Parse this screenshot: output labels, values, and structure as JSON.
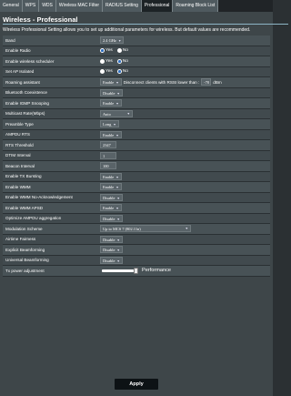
{
  "tabs": [
    "General",
    "WPS",
    "WDS",
    "Wireless MAC Filter",
    "RADIUS Setting",
    "Professional",
    "Roaming Block List"
  ],
  "active_tab": "Professional",
  "title": "Wireless - Professional",
  "description": "Wireless Professional Setting allows you to set up additional parameters for wireless. But default values are recommended.",
  "radio_yes": "Yes",
  "radio_no": "No",
  "rows": {
    "band": {
      "label": "Band",
      "value": "2.4 GHz"
    },
    "enable_radio": {
      "label": "Enable Radio",
      "selected": "Yes"
    },
    "scheduler": {
      "label": "Enable wireless scheduler",
      "selected": "No"
    },
    "ap_isolated": {
      "label": "Set AP Isolated",
      "selected": "No"
    },
    "roaming": {
      "label": "Roaming assistant",
      "value": "Enable",
      "text": "Disconnect clients with RSSI lower than :",
      "rssi": "-70",
      "unit": "dBm"
    },
    "bt": {
      "label": "Bluetooth Coexistence",
      "value": "Disable"
    },
    "igmp": {
      "label": "Enable IGMP Snooping",
      "value": "Enable"
    },
    "multicast": {
      "label": "Multicast Rate(Mbps)",
      "value": "Auto"
    },
    "preamble": {
      "label": "Preamble Type",
      "value": "Long"
    },
    "ampdu": {
      "label": "AMPDU RTS",
      "value": "Enable"
    },
    "rts": {
      "label": "RTS Threshold",
      "value": "2347"
    },
    "dtim": {
      "label": "DTIM Interval",
      "value": "1"
    },
    "beacon": {
      "label": "Beacon Interval",
      "value": "100"
    },
    "txburst": {
      "label": "Enable TX Bursting",
      "value": "Enable"
    },
    "wmm": {
      "label": "Enable WMM",
      "value": "Enable"
    },
    "wmm_noack": {
      "label": "Enable WMM No-Acknowledgement",
      "value": "Disable"
    },
    "wmm_apsd": {
      "label": "Enable WMM APSD",
      "value": "Enable"
    },
    "ampdu_agg": {
      "label": "Optimize AMPDU aggregation",
      "value": "Disable"
    },
    "modulation": {
      "label": "Modulation Scheme",
      "value": "Up to MCS 7 (802.11n)"
    },
    "airtime": {
      "label": "Airtime Fairness",
      "value": "Disable"
    },
    "explicit": {
      "label": "Explicit Beamforming",
      "value": "Disable"
    },
    "universal": {
      "label": "Universal Beamforming",
      "value": "Disable"
    },
    "txpower": {
      "label": "Tx power adjustment",
      "text": "Performance",
      "level_percent": 100
    }
  },
  "apply_label": "Apply"
}
